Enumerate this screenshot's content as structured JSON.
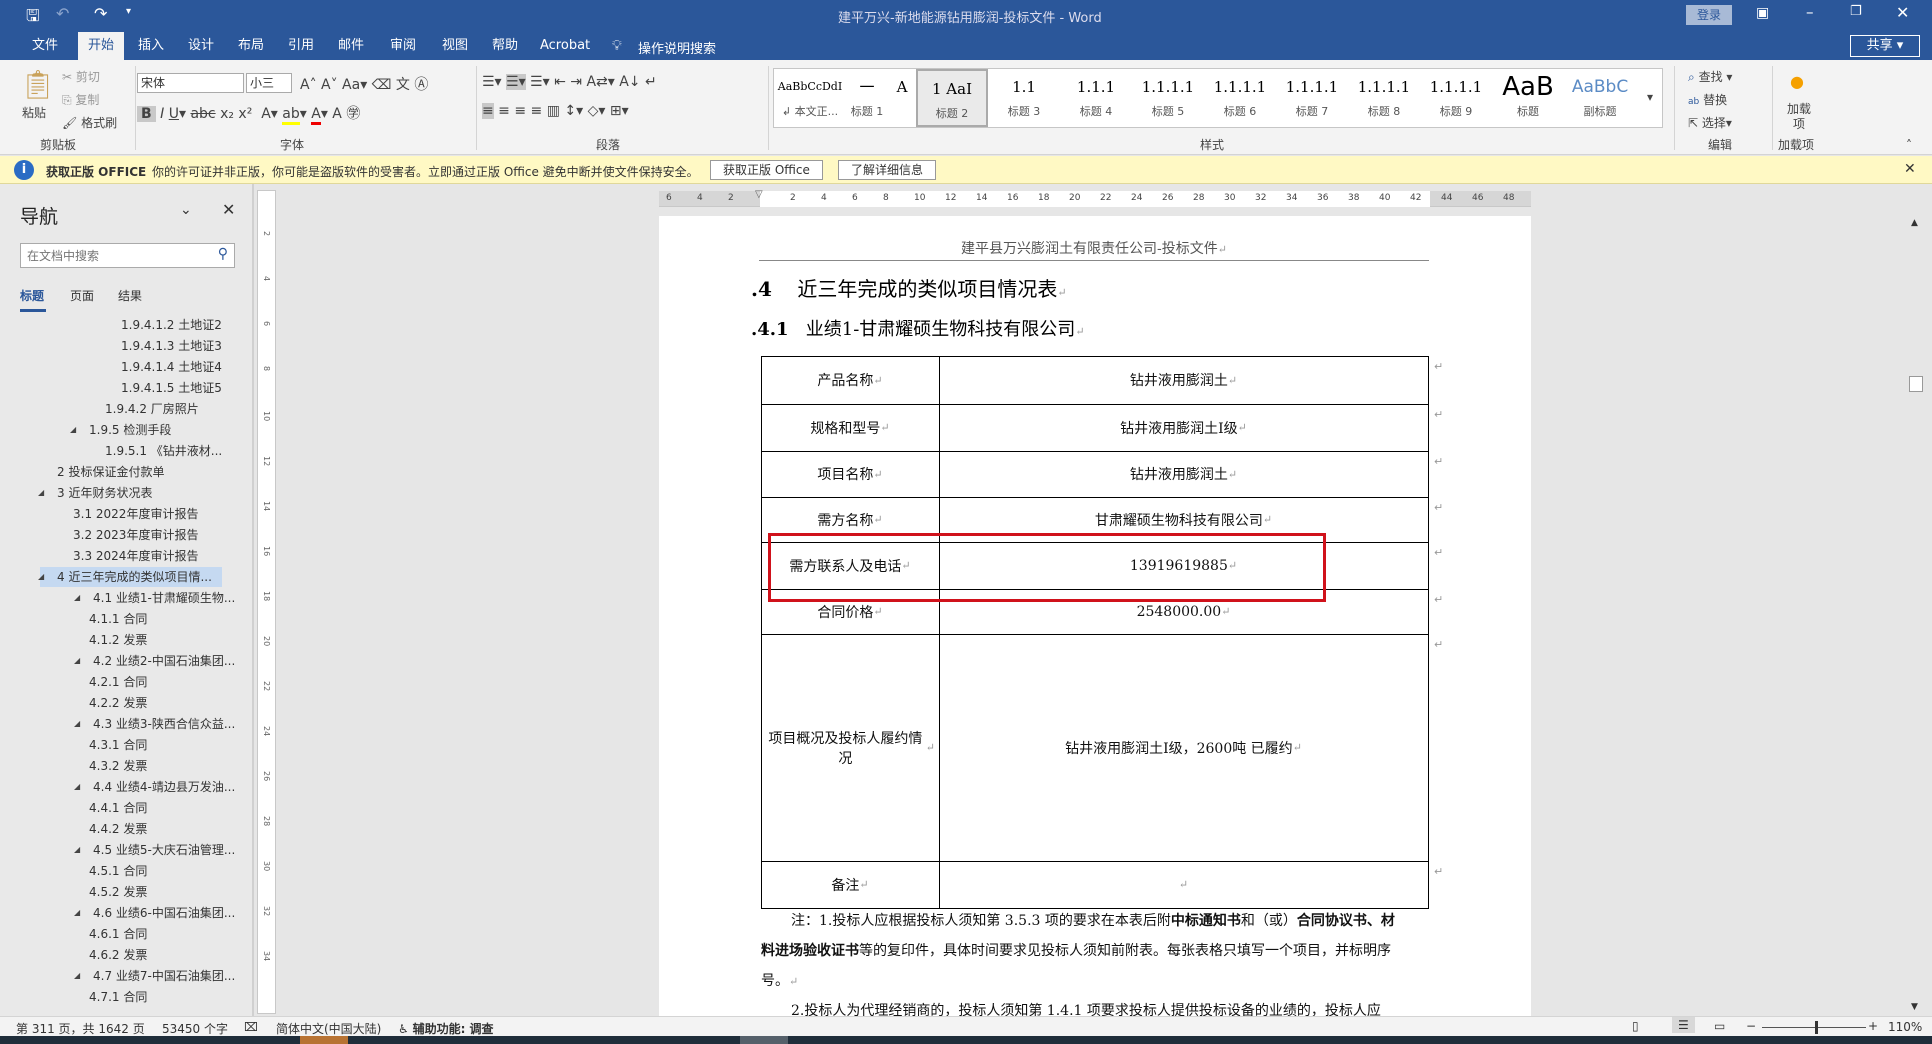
{
  "window": {
    "title": "建平万兴-新地能源钻用膨润-投标文件  -  Word",
    "login": "登录",
    "share": "共享"
  },
  "ribbon_tabs": [
    "文件",
    "开始",
    "插入",
    "设计",
    "布局",
    "引用",
    "邮件",
    "审阅",
    "视图",
    "帮助",
    "Acrobat"
  ],
  "active_tab": "开始",
  "tell_me": "操作说明搜索",
  "clipboard": {
    "paste": "粘贴",
    "cut": "剪切",
    "copy": "复制",
    "format_painter": "格式刷",
    "label": "剪贴板"
  },
  "font": {
    "name": "宋体",
    "size": "小三",
    "label": "字体"
  },
  "paragraph": {
    "label": "段落"
  },
  "styles": {
    "label": "样式",
    "items": [
      {
        "preview": "AaBbCcDdI",
        "name": "↲ 本文正..."
      },
      {
        "preview": "一",
        "name": "标题 1"
      },
      {
        "preview": "A",
        "name": ""
      },
      {
        "preview": "1   AaI",
        "name": "标题 2"
      },
      {
        "preview": "1.1",
        "name": "标题 3"
      },
      {
        "preview": "1.1.1",
        "name": "标题 4"
      },
      {
        "preview": "1.1.1.1",
        "name": "标题 5"
      },
      {
        "preview": "1.1.1.1",
        "name": "标题 6"
      },
      {
        "preview": "1.1.1.1",
        "name": "标题 7"
      },
      {
        "preview": "1.1.1.1",
        "name": "标题 8"
      },
      {
        "preview": "1.1.1.1",
        "name": "标题 9"
      },
      {
        "preview": "AaB",
        "name": "标题"
      },
      {
        "preview": "AaBbC",
        "name": "副标题"
      }
    ]
  },
  "editing": {
    "find": "查找",
    "replace": "替换",
    "select": "选择",
    "label": "编辑"
  },
  "addins": {
    "button": "加载项",
    "label": "加载项"
  },
  "message_bar": {
    "title": "获取正版 OFFICE",
    "text": "你的许可证并非正版，你可能是盗版软件的受害者。立即通过正版 Office 避免中断并使文件保持安全。",
    "btn1": "获取正版 Office",
    "btn2": "了解详细信息"
  },
  "nav": {
    "title": "导航",
    "search_placeholder": "在文档中搜索",
    "tabs": [
      "标题",
      "页面",
      "结果"
    ],
    "items": [
      {
        "t": "1.9.4.1.2 土地证2",
        "l": 4
      },
      {
        "t": "1.9.4.1.3 土地证3",
        "l": 4
      },
      {
        "t": "1.9.4.1.4 土地证4",
        "l": 4
      },
      {
        "t": "1.9.4.1.5 土地证5",
        "l": 4
      },
      {
        "t": "1.9.4.2 厂房照片",
        "l": 3
      },
      {
        "t": "1.9.5 检测手段",
        "l": 2,
        "e": 1
      },
      {
        "t": "1.9.5.1 《钻井液材...",
        "l": 3
      },
      {
        "t": "2 投标保证金付款单",
        "l": 0
      },
      {
        "t": "3 近年财务状况表",
        "l": 0,
        "e": 1
      },
      {
        "t": "3.1 2022年度审计报告",
        "l": 1
      },
      {
        "t": "3.2 2023年度审计报告",
        "l": 1
      },
      {
        "t": "3.3 2024年度审计报告",
        "l": 1
      },
      {
        "t": "4 近三年完成的类似项目情...",
        "l": 0,
        "e": 1,
        "s": 1
      },
      {
        "t": "4.1 业绩1-甘肃耀硕生物...",
        "l": 1,
        "e": 1
      },
      {
        "t": "4.1.1 合同",
        "l": 2
      },
      {
        "t": "4.1.2 发票",
        "l": 2
      },
      {
        "t": "4.2 业绩2-中国石油集团...",
        "l": 1,
        "e": 1
      },
      {
        "t": "4.2.1 合同",
        "l": 2
      },
      {
        "t": "4.2.2 发票",
        "l": 2
      },
      {
        "t": "4.3 业绩3-陕西合信众益...",
        "l": 1,
        "e": 1
      },
      {
        "t": "4.3.1 合同",
        "l": 2
      },
      {
        "t": "4.3.2 发票",
        "l": 2
      },
      {
        "t": "4.4 业绩4-靖边县万发油...",
        "l": 1,
        "e": 1
      },
      {
        "t": "4.4.1 合同",
        "l": 2
      },
      {
        "t": "4.4.2 发票",
        "l": 2
      },
      {
        "t": "4.5 业绩5-大庆石油管理...",
        "l": 1,
        "e": 1
      },
      {
        "t": "4.5.1 合同",
        "l": 2
      },
      {
        "t": "4.5.2 发票",
        "l": 2
      },
      {
        "t": "4.6 业绩6-中国石油集团...",
        "l": 1,
        "e": 1
      },
      {
        "t": "4.6.1 合同",
        "l": 2
      },
      {
        "t": "4.6.2 发票",
        "l": 2
      },
      {
        "t": "4.7 业绩7-中国石油集团...",
        "l": 1,
        "e": 1
      },
      {
        "t": "4.7.1 合同",
        "l": 2
      }
    ]
  },
  "ruler_ticks": [
    "6",
    "4",
    "2",
    "",
    "2",
    "4",
    "6",
    "8",
    "10",
    "12",
    "14",
    "16",
    "18",
    "20",
    "22",
    "24",
    "26",
    "28",
    "30",
    "32",
    "34",
    "36",
    "38",
    "40",
    "42",
    "44",
    "46",
    "48"
  ],
  "document": {
    "header": "建平县万兴膨润土有限责任公司-投标文件",
    "h1": {
      "num": ".4",
      "text": "近三年完成的类似项目情况表"
    },
    "h2": {
      "num": ".4.1",
      "text": "业绩1-甘肃耀硕生物科技有限公司"
    },
    "table": [
      [
        "产品名称",
        "钻井液用膨润土"
      ],
      [
        "规格和型号",
        "钻井液用膨润土Ⅰ级"
      ],
      [
        "项目名称",
        "钻井液用膨润土"
      ],
      [
        "需方名称",
        "甘肃耀硕生物科技有限公司"
      ],
      [
        "需方联系人及电话",
        "13919619885"
      ],
      [
        "合同价格",
        "2548000.00"
      ],
      [
        "项目概况及投标人履约情况",
        "钻井液用膨润土Ⅰ级，2600吨  已履约"
      ],
      [
        "备注",
        ""
      ]
    ],
    "highlight_color": "#d0121b",
    "note1a": "注：1.投标人应根据投标人须知第 3.5.3 项的要求在本表后附",
    "note1b": "中标通知书",
    "note1c": "和（或）",
    "note1d": "合同协议书、材",
    "note2a": "料进场验收证书",
    "note2b": "等的复印件，具体时间要求见投标人须知前附表。每张表格只填写一个项目，并标明序",
    "note3": "号。",
    "note4": "2.投标人为代理经销商的，投标人须知第  1.4.1  项要求投标人提供投标设备的业绩的，投标人应"
  },
  "status": {
    "page": "第 311 页，共 1642 页",
    "words": "53450 个字",
    "language": "简体中文(中国大陆)",
    "accessibility": "辅助功能: 调查",
    "zoom": "110%",
    "zoom_level": 110
  }
}
